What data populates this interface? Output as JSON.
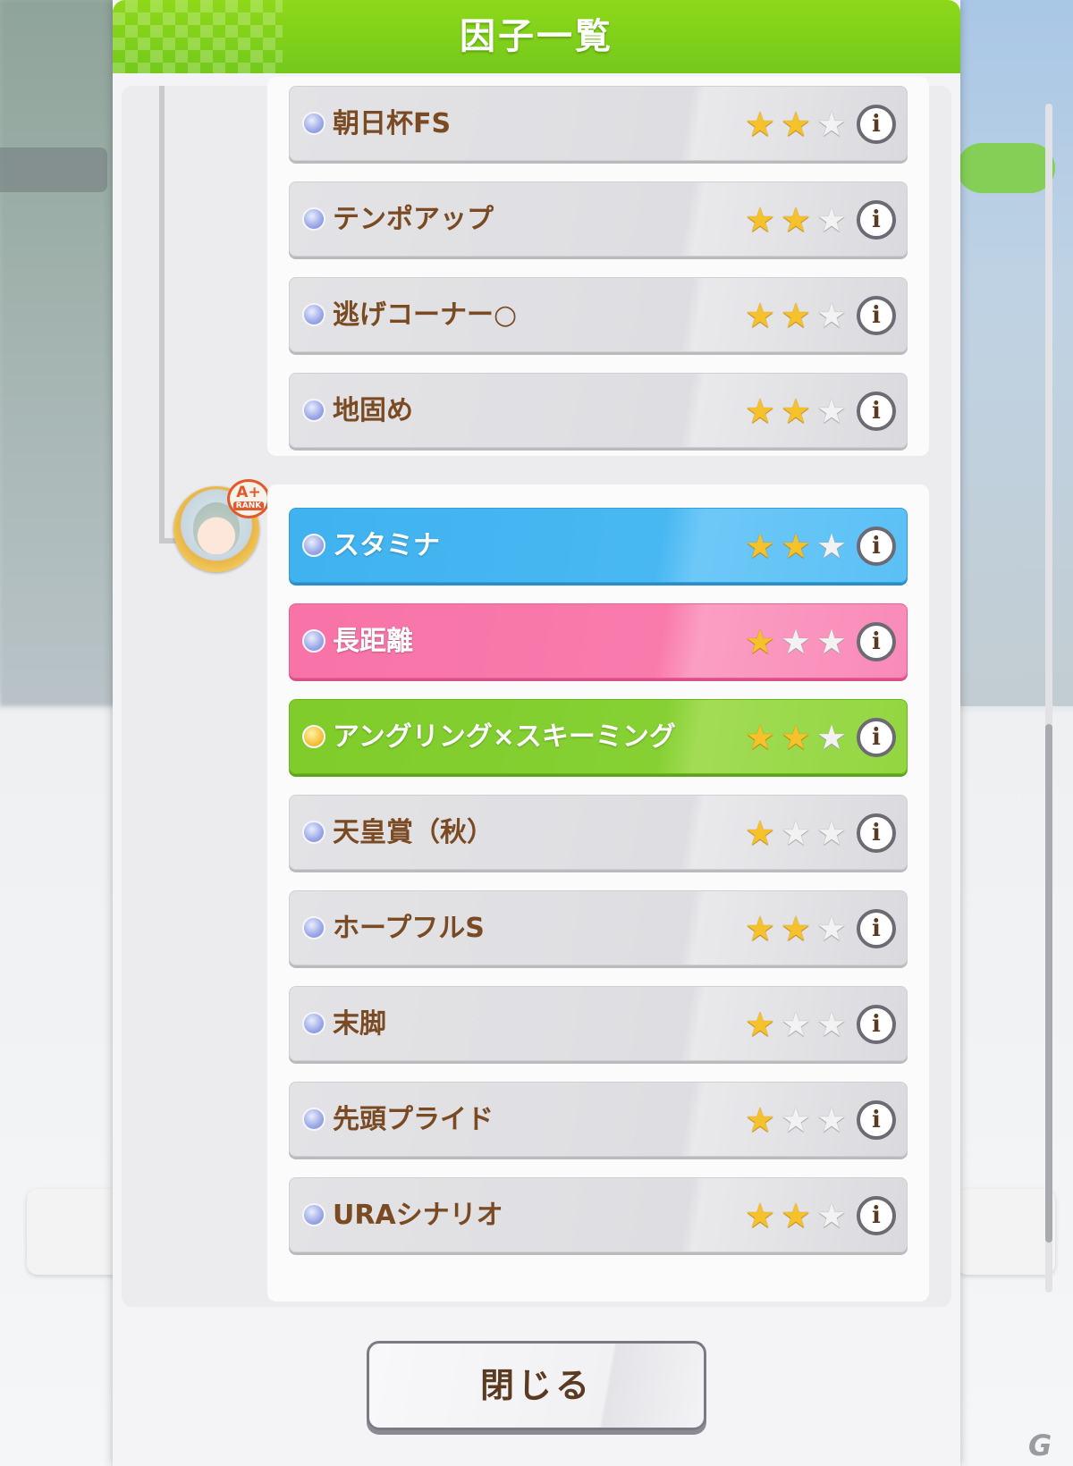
{
  "dialog": {
    "title": "因子一覧",
    "close_label": "閉じる"
  },
  "rank_badge": {
    "rank": "A+",
    "label": "RANK"
  },
  "groups": [
    {
      "factors": [
        {
          "name": "朝日杯FS",
          "stars": 2,
          "color": "gray",
          "dot": "blue"
        },
        {
          "name": "テンポアップ",
          "stars": 2,
          "color": "gray",
          "dot": "blue"
        },
        {
          "name": "逃げコーナー○",
          "stars": 2,
          "color": "gray",
          "dot": "blue"
        },
        {
          "name": "地固め",
          "stars": 2,
          "color": "gray",
          "dot": "blue"
        }
      ]
    },
    {
      "factors": [
        {
          "name": "スタミナ",
          "stars": 2,
          "color": "blue",
          "dot": "blue"
        },
        {
          "name": "長距離",
          "stars": 1,
          "color": "pink",
          "dot": "blue"
        },
        {
          "name": "アングリング×スキーミング",
          "stars": 2,
          "color": "green",
          "dot": "gold"
        },
        {
          "name": "天皇賞（秋）",
          "stars": 1,
          "color": "gray",
          "dot": "blue"
        },
        {
          "name": "ホープフルS",
          "stars": 2,
          "color": "gray",
          "dot": "blue"
        },
        {
          "name": "末脚",
          "stars": 1,
          "color": "gray",
          "dot": "blue"
        },
        {
          "name": "先頭プライド",
          "stars": 1,
          "color": "gray",
          "dot": "blue"
        },
        {
          "name": "URAシナリオ",
          "stars": 2,
          "color": "gray",
          "dot": "blue"
        }
      ]
    }
  ],
  "icons": {
    "info": "info-icon",
    "star": "star-icon",
    "factor_dot": "factor-gem-icon"
  },
  "colors": {
    "header_green": "#74c91b",
    "stamina_blue": "#49b8f2",
    "distance_pink": "#f97bac",
    "unique_green": "#86d033",
    "text_brown": "#7a4a23",
    "star_gold": "#f6c22b"
  },
  "watermark": "G"
}
